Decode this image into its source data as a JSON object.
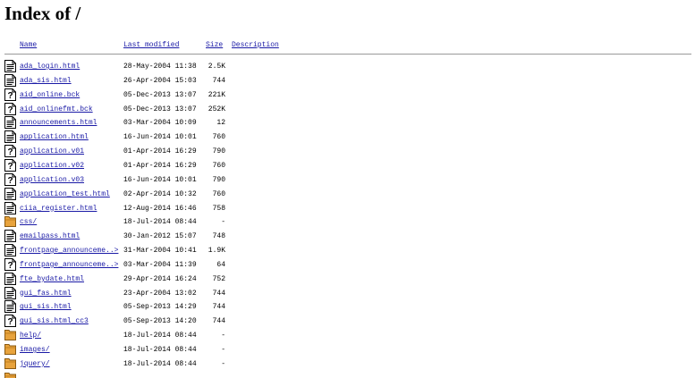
{
  "page": {
    "title": "Index of /"
  },
  "columns": {
    "name": "Name",
    "last_modified": "Last modified",
    "size": "Size",
    "description": "Description"
  },
  "entries": [
    {
      "icon": "text-file-icon",
      "name": "ada_login.html",
      "modified": "28-May-2004 11:38",
      "size": "2.5K"
    },
    {
      "icon": "text-file-icon",
      "name": "ada_sis.html",
      "modified": "26-Apr-2004 15:03",
      "size": "744"
    },
    {
      "icon": "unknown-file-icon",
      "name": "aid_online.bck",
      "modified": "05-Dec-2013 13:07",
      "size": "221K"
    },
    {
      "icon": "unknown-file-icon",
      "name": "aid_onlinefmt.bck",
      "modified": "05-Dec-2013 13:07",
      "size": "252K"
    },
    {
      "icon": "text-file-icon",
      "name": "announcements.html",
      "modified": "03-Mar-2004 10:09",
      "size": "12"
    },
    {
      "icon": "text-file-icon",
      "name": "application.html",
      "modified": "16-Jun-2014 10:01",
      "size": "760"
    },
    {
      "icon": "unknown-file-icon",
      "name": "application.v01",
      "modified": "01-Apr-2014 16:29",
      "size": "790"
    },
    {
      "icon": "unknown-file-icon",
      "name": "application.v02",
      "modified": "01-Apr-2014 16:29",
      "size": "760"
    },
    {
      "icon": "unknown-file-icon",
      "name": "application.v03",
      "modified": "16-Jun-2014 10:01",
      "size": "790"
    },
    {
      "icon": "text-file-icon",
      "name": "application_test.html",
      "modified": "02-Apr-2014 10:32",
      "size": "760"
    },
    {
      "icon": "text-file-icon",
      "name": "ciia_register.html",
      "modified": "12-Aug-2014 16:46",
      "size": "758"
    },
    {
      "icon": "folder-icon",
      "name": "css/",
      "modified": "18-Jul-2014 08:44",
      "size": "-"
    },
    {
      "icon": "text-file-icon",
      "name": "emailpass.html",
      "modified": "30-Jan-2012 15:07",
      "size": "748"
    },
    {
      "icon": "text-file-icon",
      "name": "frontpage_announceme..>",
      "modified": "31-Mar-2004 10:41",
      "size": "1.9K"
    },
    {
      "icon": "unknown-file-icon",
      "name": "frontpage_announceme..>",
      "modified": "03-Mar-2004 11:39",
      "size": "64"
    },
    {
      "icon": "text-file-icon",
      "name": "fte_bydate.html",
      "modified": "29-Apr-2014 16:24",
      "size": "752"
    },
    {
      "icon": "text-file-icon",
      "name": "gui_fas.html",
      "modified": "23-Apr-2004 13:02",
      "size": "744"
    },
    {
      "icon": "text-file-icon",
      "name": "gui_sis.html",
      "modified": "05-Sep-2013 14:29",
      "size": "744"
    },
    {
      "icon": "unknown-file-icon",
      "name": "gui_sis.html_cc3",
      "modified": "05-Sep-2013 14:20",
      "size": "744"
    },
    {
      "icon": "folder-icon",
      "name": "help/",
      "modified": "18-Jul-2014 08:44",
      "size": "-"
    },
    {
      "icon": "folder-icon",
      "name": "images/",
      "modified": "18-Jul-2014 08:44",
      "size": "-"
    },
    {
      "icon": "folder-icon",
      "name": "jquery/",
      "modified": "18-Jul-2014 08:44",
      "size": "-"
    },
    {
      "icon": "folder-icon",
      "name": "",
      "modified": "",
      "size": ""
    }
  ],
  "colors": {
    "link": "#1a1aa6",
    "rule": "#999999",
    "folder": "#e8a33c"
  }
}
